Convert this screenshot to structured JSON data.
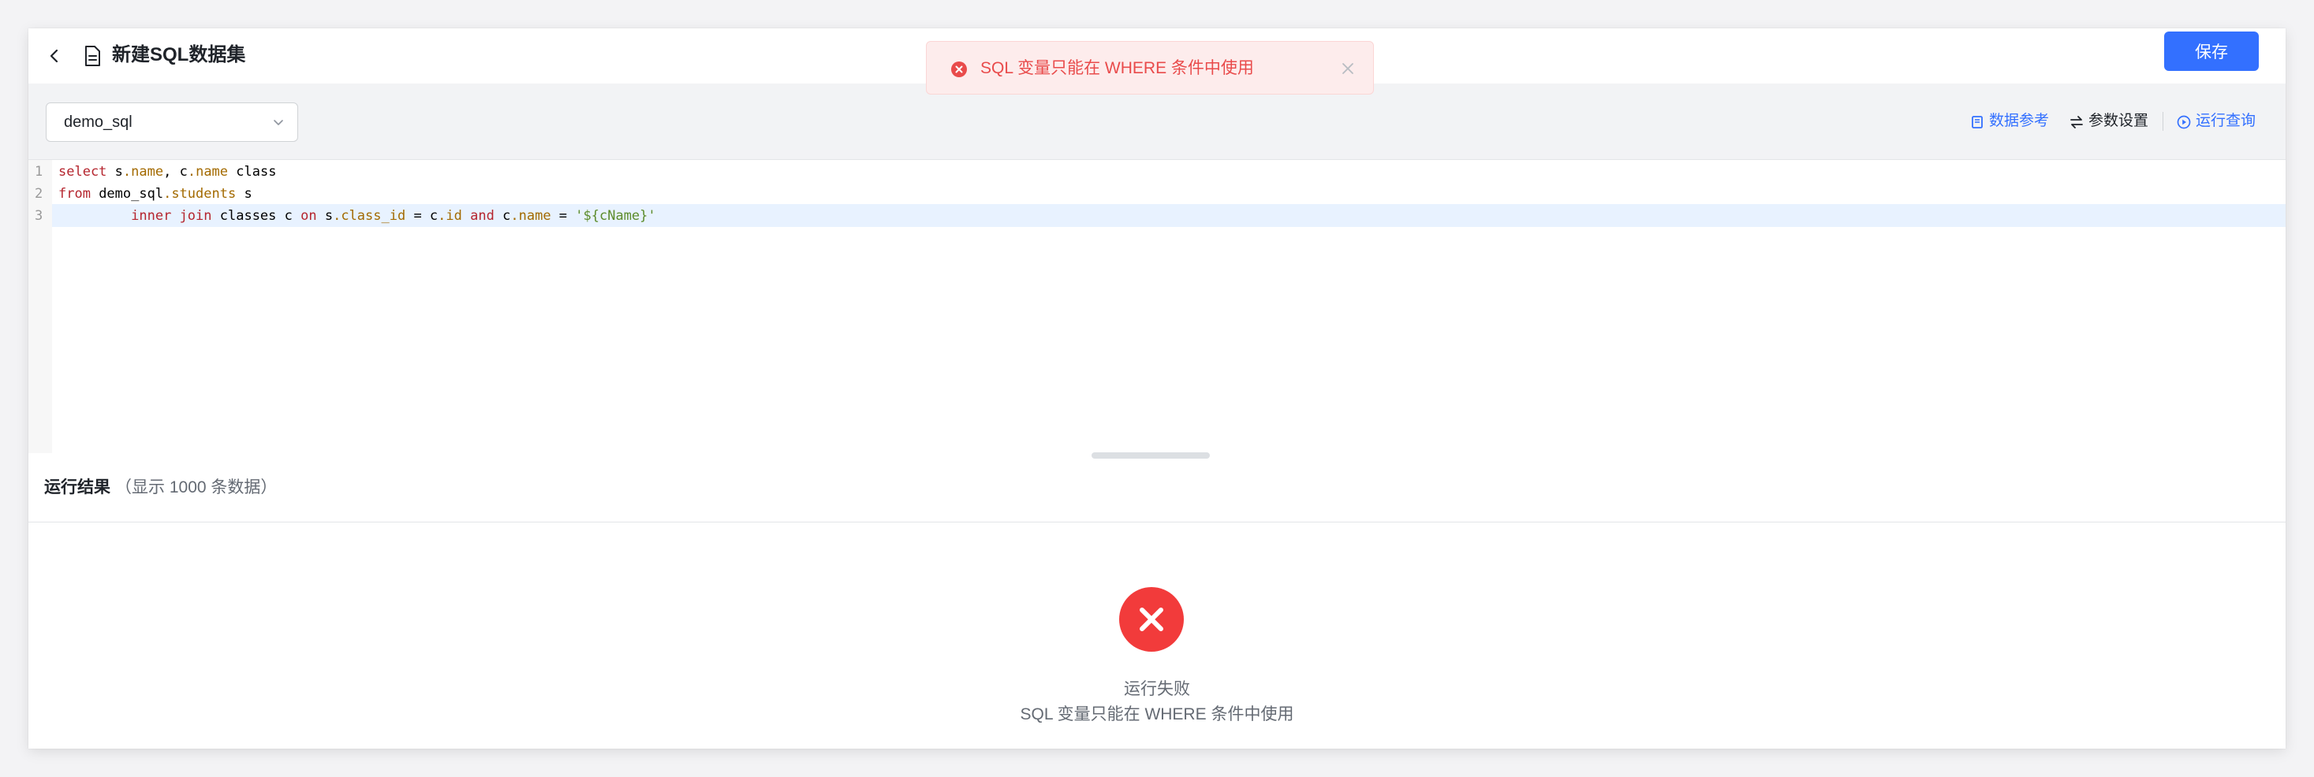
{
  "header": {
    "title": "新建SQL数据集",
    "save_label": "保存"
  },
  "toast": {
    "message": "SQL 变量只能在 WHERE 条件中使用",
    "icon": "error-circle-icon"
  },
  "toolbar": {
    "datasource": "demo_sql",
    "data_reference": "数据参考",
    "param_settings": "参数设置",
    "run_query": "运行查询"
  },
  "editor": {
    "line_numbers": [
      "1",
      "2",
      "3"
    ],
    "lines": [
      "select s.name, c.name class",
      "from demo_sql.students s",
      "         inner join classes c on s.class_id = c.id and c.name = '${cName}'"
    ]
  },
  "results": {
    "title": "运行结果",
    "count_note": "（显示 1000 条数据）",
    "error_title": "运行失败",
    "error_message": "SQL 变量只能在 WHERE 条件中使用"
  },
  "colors": {
    "primary": "#3370ff",
    "error": "#e94b4b",
    "error_icon_bg": "#f23b3b"
  }
}
